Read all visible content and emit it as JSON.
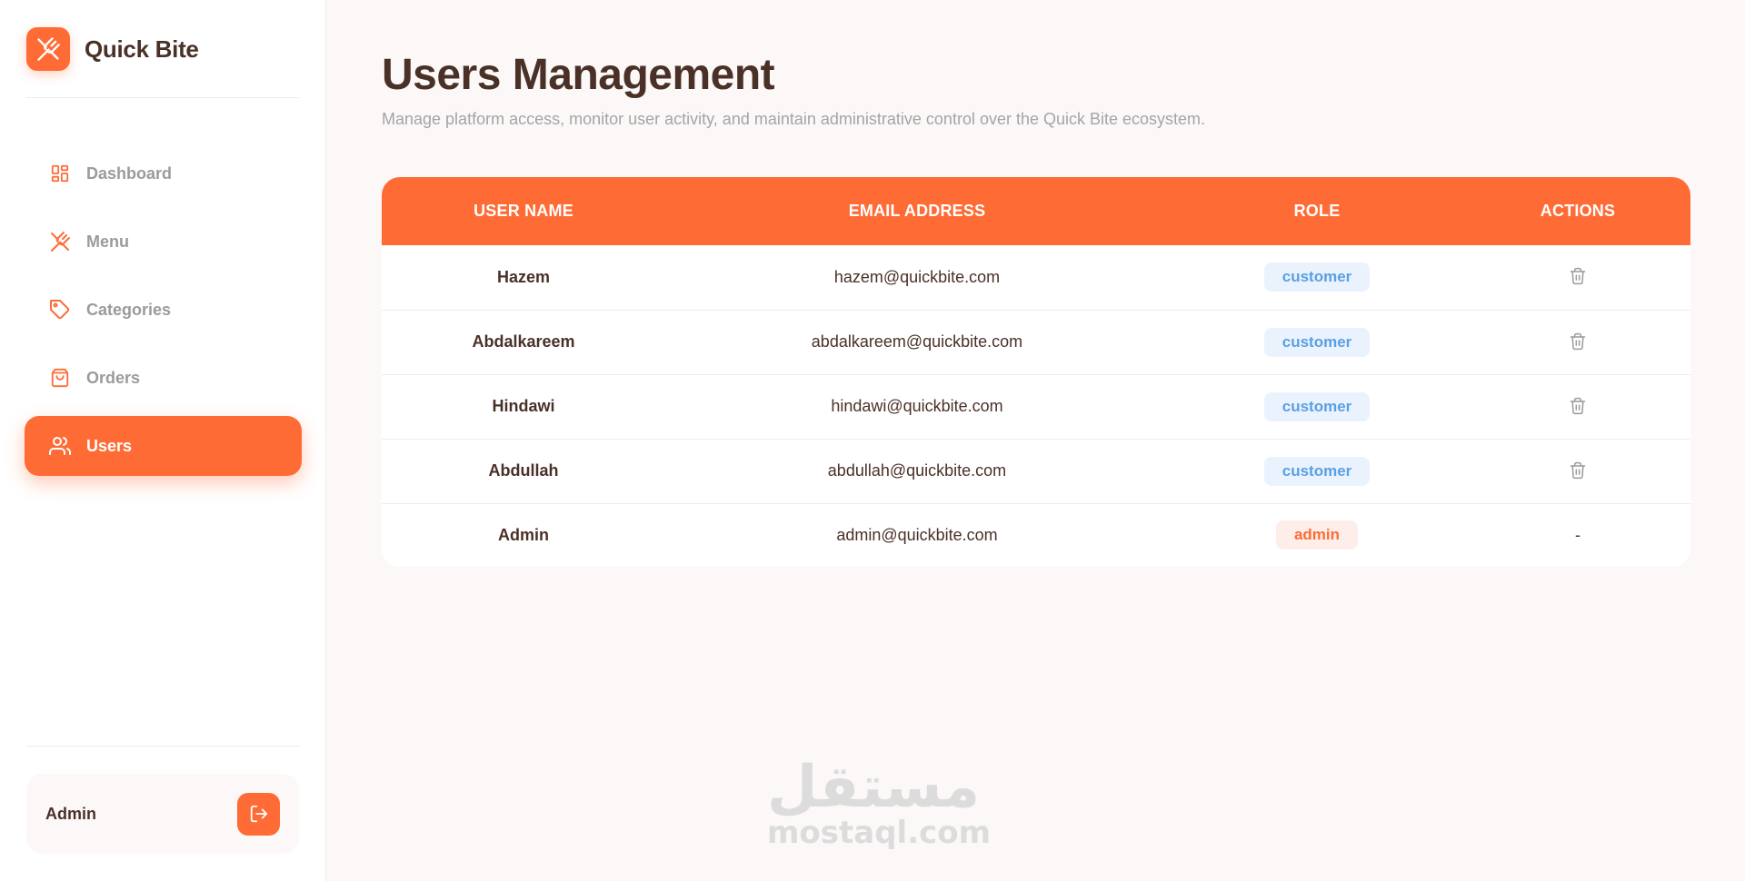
{
  "app": {
    "name": "Quick Bite",
    "accent": "#ff6b35",
    "text_dark": "#4a3128"
  },
  "sidebar": {
    "items": [
      {
        "label": "Dashboard",
        "icon": "dashboard-grid-icon",
        "active": false
      },
      {
        "label": "Menu",
        "icon": "utensils-icon",
        "active": false
      },
      {
        "label": "Categories",
        "icon": "tag-icon",
        "active": false
      },
      {
        "label": "Orders",
        "icon": "shopping-bag-icon",
        "active": false
      },
      {
        "label": "Users",
        "icon": "users-icon",
        "active": true
      }
    ],
    "user": {
      "name": "Admin",
      "logout_icon": "logout-icon"
    }
  },
  "main": {
    "title": "Users Management",
    "subtitle": "Manage platform access, monitor user activity, and maintain administrative control over the Quick Bite ecosystem.",
    "table": {
      "headers": [
        "USER NAME",
        "EMAIL ADDRESS",
        "ROLE",
        "ACTIONS"
      ],
      "rows": [
        {
          "name": "Hazem",
          "email": "hazem@quickbite.com",
          "role": "customer",
          "action": "trash-icon"
        },
        {
          "name": "Abdalkareem",
          "email": "abdalkareem@quickbite.com",
          "role": "customer",
          "action": "trash-icon"
        },
        {
          "name": "Hindawi",
          "email": "hindawi@quickbite.com",
          "role": "customer",
          "action": "trash-icon"
        },
        {
          "name": "Abdullah",
          "email": "abdullah@quickbite.com",
          "role": "customer",
          "action": "trash-icon"
        },
        {
          "name": "Admin",
          "email": "admin@quickbite.com",
          "role": "admin",
          "action": "-"
        }
      ]
    }
  },
  "watermark": {
    "arabic": "مستقل",
    "latin": "mostaql.com"
  }
}
